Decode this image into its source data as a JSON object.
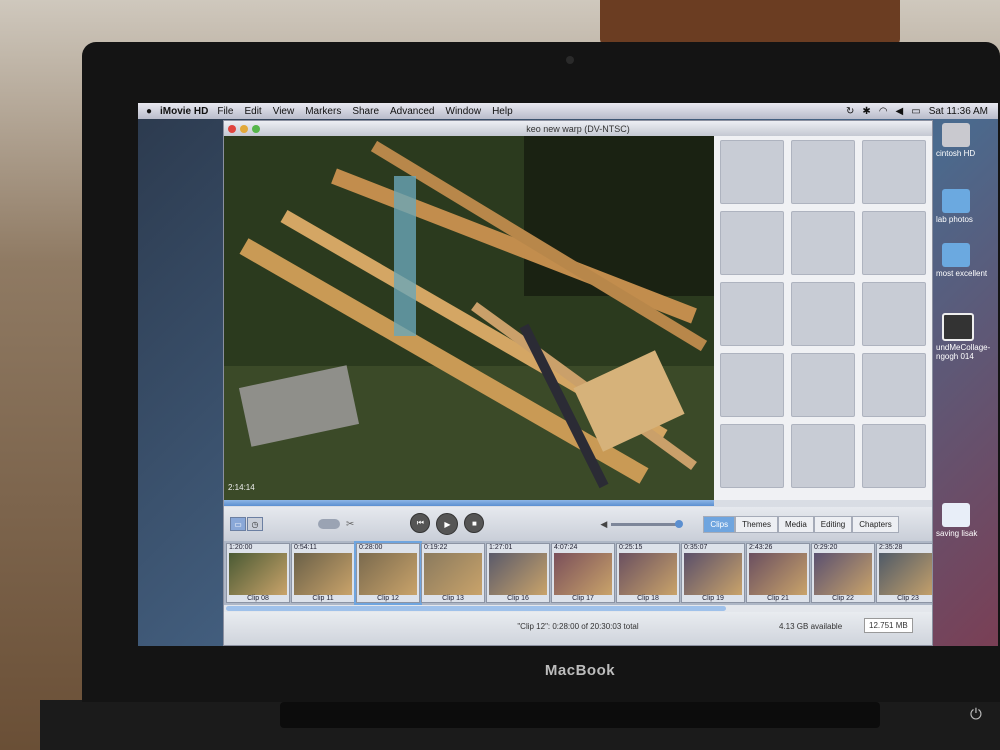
{
  "laptop": {
    "brand": "MacBook"
  },
  "menubar": {
    "app_name": "iMovie HD",
    "items": [
      "File",
      "Edit",
      "View",
      "Markers",
      "Share",
      "Advanced",
      "Window",
      "Help"
    ],
    "clock": "Sat 11:36 AM"
  },
  "window": {
    "title": "keo new warp (DV-NTSC)",
    "viewer_timecode": "2:14:14"
  },
  "controls": {
    "transport": [
      "rewind",
      "play",
      "play-fullscreen"
    ],
    "pane_tabs": [
      "Clips",
      "Themes",
      "Media",
      "Editing",
      "Chapters"
    ],
    "active_tab": "Clips",
    "volume_fraction": 0.95
  },
  "clips": [
    {
      "duration": "1:20:00",
      "name": "Clip 08"
    },
    {
      "duration": "0:54:11",
      "name": "Clip 11"
    },
    {
      "duration": "0:28:00",
      "name": "Clip 12"
    },
    {
      "duration": "0:19:22",
      "name": "Clip 13"
    },
    {
      "duration": "1:27:01",
      "name": "Clip 16"
    },
    {
      "duration": "4:07:24",
      "name": "Clip 17"
    },
    {
      "duration": "0:25:15",
      "name": "Clip 18"
    },
    {
      "duration": "0:35:07",
      "name": "Clip 19"
    },
    {
      "duration": "2:43:26",
      "name": "Clip 21"
    },
    {
      "duration": "0:29:20",
      "name": "Clip 22"
    },
    {
      "duration": "2:35:28",
      "name": "Clip 23"
    }
  ],
  "status": {
    "selection": "\"Clip 12\": 0:28:00 of 20:30:03 total",
    "available": "4.13 GB available",
    "size": "12.751 MB"
  },
  "desktop": {
    "icons": [
      {
        "label": "cintosh HD",
        "kind": "hard-drive-icon"
      },
      {
        "label": "lab photos",
        "kind": "folder-icon"
      },
      {
        "label": "most excellent",
        "kind": "folder-icon"
      },
      {
        "label": "undMeCollage-\nngogh 014",
        "kind": "image-file-icon"
      },
      {
        "label": "saving lisak",
        "kind": "document-icon"
      }
    ]
  },
  "colors": {
    "accent": "#6fa5df",
    "close": "#e0443e",
    "minimize": "#e2a93a",
    "zoom": "#56b64a"
  }
}
